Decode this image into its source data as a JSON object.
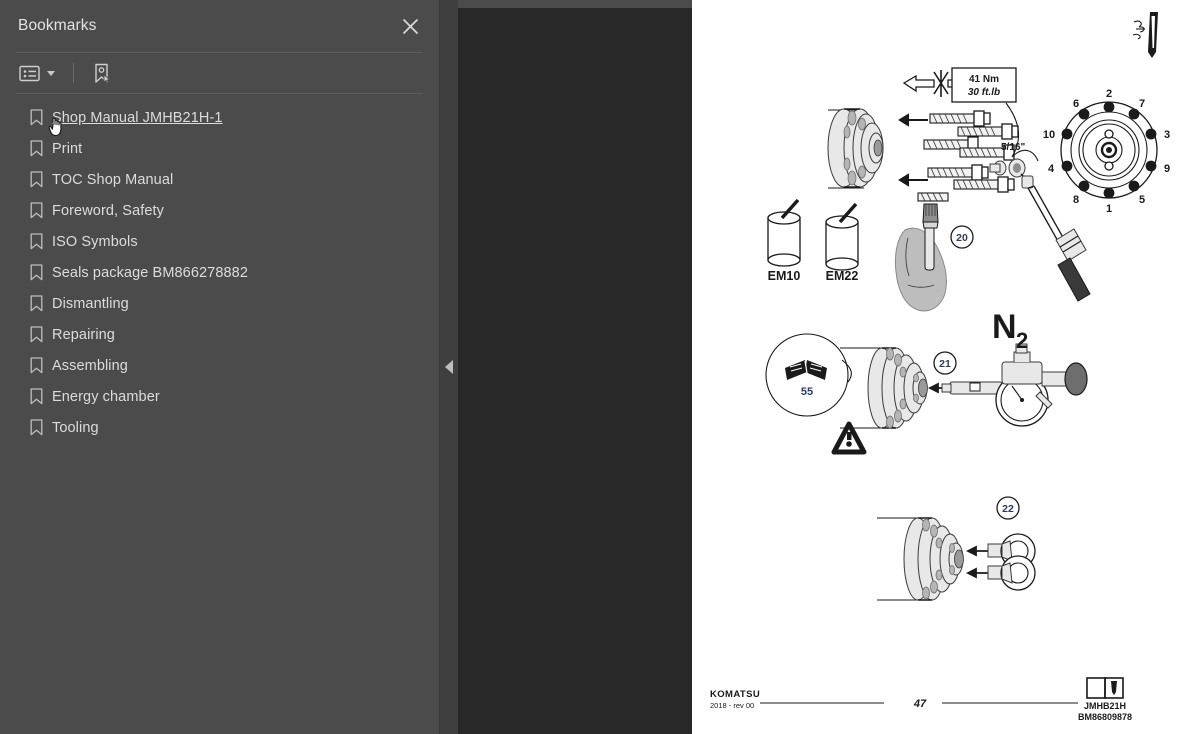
{
  "panel": {
    "title": "Bookmarks",
    "close_icon": "close-icon",
    "toolbar": {
      "options_icon": "list-options-icon",
      "caret_icon": "chevron-down-icon",
      "new_bookmark_icon": "new-bookmark-icon"
    },
    "items": [
      {
        "label": "Shop Manual JMHB21H-1",
        "icon": "bookmark-icon",
        "hovered": true
      },
      {
        "label": "Print",
        "icon": "bookmark-icon",
        "hovered": false
      },
      {
        "label": "TOC Shop Manual",
        "icon": "bookmark-icon",
        "hovered": false
      },
      {
        "label": "Foreword, Safety",
        "icon": "bookmark-icon",
        "hovered": false
      },
      {
        "label": "ISO Symbols",
        "icon": "bookmark-icon",
        "hovered": false
      },
      {
        "label": "Seals package BM866278882",
        "icon": "bookmark-icon",
        "hovered": false
      },
      {
        "label": "Dismantling",
        "icon": "bookmark-icon",
        "hovered": false
      },
      {
        "label": "Repairing",
        "icon": "bookmark-icon",
        "hovered": false
      },
      {
        "label": "Assembling",
        "icon": "bookmark-icon",
        "hovered": false
      },
      {
        "label": "Energy chamber",
        "icon": "bookmark-icon",
        "hovered": false
      },
      {
        "label": "Tooling",
        "icon": "bookmark-icon",
        "hovered": false
      }
    ]
  },
  "gutter": {
    "collapse_icon": "collapse-left-arrow-icon"
  },
  "page": {
    "corner_icon": "chisel-tool-icon",
    "torque_box": {
      "metric": "41 Nm",
      "imperial": "30 ft.lb"
    },
    "socket_size": "5/16\"",
    "bolt_sequence": [
      "1",
      "2",
      "3",
      "4",
      "5",
      "6",
      "7",
      "8",
      "9",
      "10"
    ],
    "grease_wrong": "EM10",
    "grease_right": "EM22",
    "steps": [
      "20",
      "21",
      "22"
    ],
    "manual_ref": "55",
    "gas_label": "N",
    "gas_subscript": "2",
    "warning_icon": "warning-triangle-icon",
    "manual_ref_icon": "open-book-icon",
    "footer": {
      "brand": "KOMATSU",
      "revision": "2018 -  rev 00",
      "page_number": "47",
      "doc_icon": "manual-booklet-icon",
      "model": "JMHB21H",
      "part_number": "BM86809878"
    }
  },
  "colors": {
    "panel_bg": "#4b4b4b",
    "viewer_bg": "#282828",
    "page_bg": "#ffffff",
    "text": "#dcdcdc",
    "ink": "#1a1a1a",
    "number_blue": "#2b3a6b"
  }
}
